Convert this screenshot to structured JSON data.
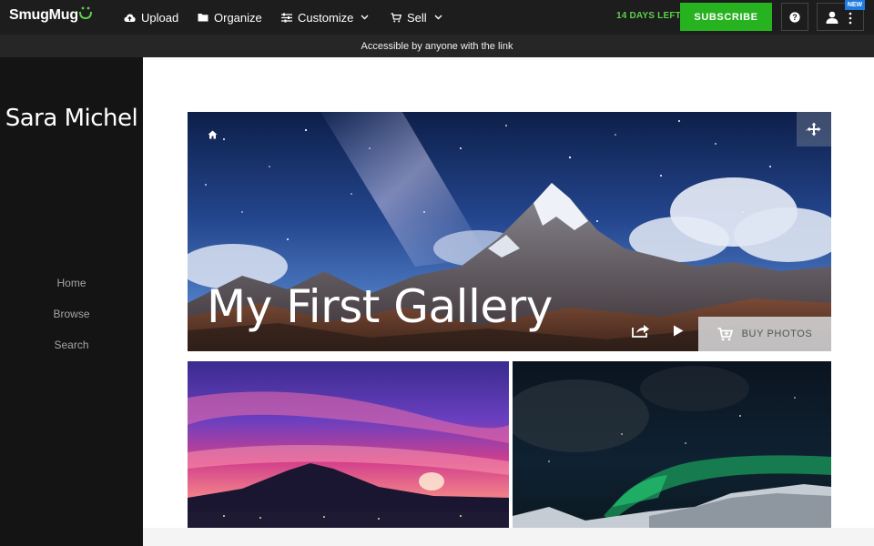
{
  "brand": {
    "name": "SmugMug"
  },
  "topbar": {
    "nav": [
      {
        "label": "Upload",
        "icon": "cloud-upload-icon"
      },
      {
        "label": "Organize",
        "icon": "folder-icon"
      },
      {
        "label": "Customize",
        "icon": "sliders-icon"
      },
      {
        "label": "Sell",
        "icon": "cart-icon"
      }
    ],
    "trial": "14 DAYS LEFT",
    "subscribe_label": "SUBSCRIBE",
    "help_label": "?",
    "new_badge": "NEW"
  },
  "banner": {
    "text": "Accessible by anyone with the link"
  },
  "sidebar": {
    "site_title": "Sara Michel",
    "links": [
      {
        "label": "Home"
      },
      {
        "label": "Browse"
      },
      {
        "label": "Search"
      }
    ]
  },
  "gallery": {
    "title": "My First Gallery",
    "buy_label": "BUY PHOTOS"
  },
  "colors": {
    "topbar": "#1d1d1d",
    "sidebar": "#141414",
    "accent_green": "#27b220",
    "trial_green": "#5bd14a",
    "badge_blue": "#1e7be0"
  }
}
